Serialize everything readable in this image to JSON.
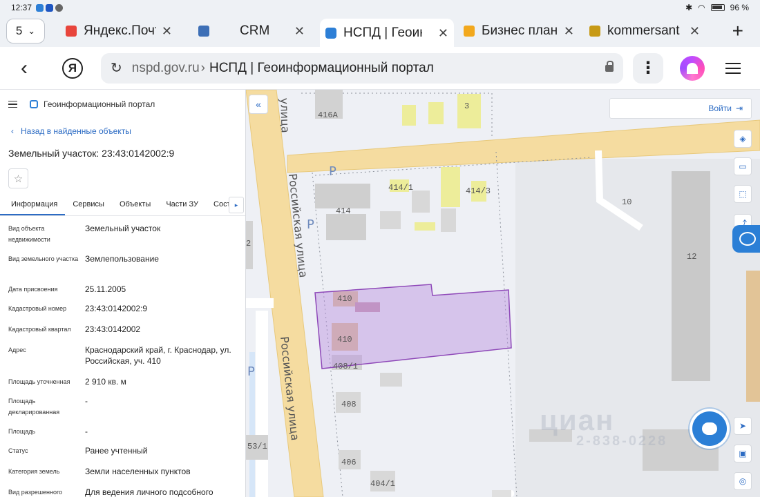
{
  "status_bar": {
    "time": "12:37",
    "battery": "96 %"
  },
  "tabs": {
    "count": "5",
    "items": [
      {
        "label": "Яндекс.Почта",
        "favicon_color": "#e8453c",
        "active": false
      },
      {
        "label": "CRM",
        "favicon_color": "#3d6fb6",
        "active": false
      },
      {
        "label": "НСПД | Геоинформационный портал",
        "favicon_color": "#2d7fd6",
        "active": true
      },
      {
        "label": "Бизнес план р",
        "favicon_color": "#f2a81d",
        "active": false
      },
      {
        "label": "kommersant",
        "favicon_color": "#c79a16",
        "active": false
      }
    ]
  },
  "address_bar": {
    "domain": "nspd.gov.ru",
    "separator": "›",
    "page_title": "НСПД | Геоинформационный портал",
    "logo_letter": "Я"
  },
  "panel": {
    "portal_title": "Геоинформационный портал",
    "back_link": "Назад в найденные объекты",
    "object_title": "Земельный участок: 23:43:0142002:9",
    "tabs": [
      "Информация",
      "Сервисы",
      "Объекты",
      "Части ЗУ",
      "Состав"
    ],
    "properties": [
      {
        "key": "Вид объекта недвижимости",
        "value": "Земельный участок"
      },
      {
        "key": "Вид земельного участка",
        "value": "Землепользование"
      },
      {
        "key": "Дата присвоения",
        "value": "25.11.2005"
      },
      {
        "key": "Кадастровый номер",
        "value": "23:43:0142002:9"
      },
      {
        "key": "Кадастровый квартал",
        "value": "23:43:0142002"
      },
      {
        "key": "Адрес",
        "value": "Краснодарский край, г. Краснодар, ул. Российская, уч. 410"
      },
      {
        "key": "Площадь уточненная",
        "value": "2 910 кв. м"
      },
      {
        "key": "Площадь декларированная",
        "value": "-"
      },
      {
        "key": "Площадь",
        "value": "-"
      },
      {
        "key": "Статус",
        "value": "Ранее учтенный"
      },
      {
        "key": "Категория земель",
        "value": "Земли населенных пунктов"
      },
      {
        "key": "Вид разрешенного",
        "value": "Для ведения личного подсобного"
      }
    ]
  },
  "map": {
    "login_label": "Войти",
    "street_name": "Российская улица",
    "street_short": "улица",
    "parking_label": "P",
    "watermark": "циан",
    "watermark_phone": "2-838-0228",
    "parcel_color": "#b98ee0",
    "building_labels": [
      "416А",
      "3",
      "414/1",
      "414/3",
      "414",
      "10",
      "12",
      "2",
      "410",
      "410",
      "408/1",
      "408",
      "406",
      "404/1",
      "53/1"
    ]
  }
}
